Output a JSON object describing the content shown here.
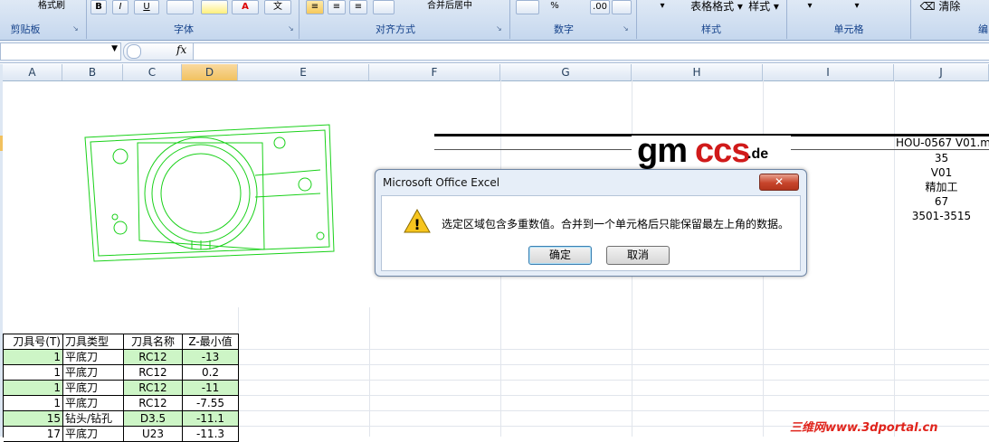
{
  "ribbon": {
    "clipboard_partial_label": "格式刷",
    "bold": "B",
    "italic": "I",
    "underline": "U",
    "wen": "文",
    "merge_center_partial": "合并后居中",
    "percent": "%",
    "decimal": ".00",
    "table_format": "表格格式",
    "styles_btn": "样式",
    "clear": "清除",
    "groups": {
      "clipboard": "剪贴板",
      "font": "字体",
      "alignment": "对齐方式",
      "number": "数字",
      "styles": "样式",
      "cells": "单元格",
      "editing_partial": "编"
    },
    "colors": {
      "label": "#15428b",
      "ribbon_bg": "#c5d7ee"
    }
  },
  "formula_bar": {
    "name_box_value": "",
    "fx_icon": "fx",
    "formula_value": ""
  },
  "columns": [
    "A",
    "B",
    "C",
    "D",
    "E",
    "F",
    "G",
    "H",
    "I",
    "J"
  ],
  "selected_column": "D",
  "tool_table": {
    "headers": [
      "刀具号(T)",
      "刀具类型",
      "刀具名称",
      "Z-最小值"
    ],
    "rows": [
      [
        "1",
        "平底刀",
        "RC12",
        "-13"
      ],
      [
        "1",
        "平底刀",
        "RC12",
        "0.2"
      ],
      [
        "1",
        "平底刀",
        "RC12",
        "-11"
      ],
      [
        "1",
        "平底刀",
        "RC12",
        "-7.55"
      ],
      [
        "15",
        "钻头/钻孔",
        "D3.5",
        "-11.1"
      ],
      [
        "17",
        "平底刀",
        "U23",
        "-11.3"
      ]
    ],
    "row_highlight": "#cdf5c6"
  },
  "right_panel": {
    "values": [
      "HOU-0567 V01.m",
      "35",
      "V01",
      "精加工",
      "67",
      "3501-3515"
    ]
  },
  "logo": {
    "gm": "gm",
    "ccs": "ccs",
    "de": ".de",
    "gm_color": "#000000",
    "ccs_color": "#d01a1a"
  },
  "dialog": {
    "title": "Microsoft Office Excel",
    "close_glyph": "✕",
    "message": "选定区域包含多重数值。合并到一个单元格后只能保留最左上角的数据。",
    "ok_label": "确定",
    "cancel_label": "取消",
    "warning_glyph": "!"
  },
  "watermark": "三维网www.3dportal.cn"
}
